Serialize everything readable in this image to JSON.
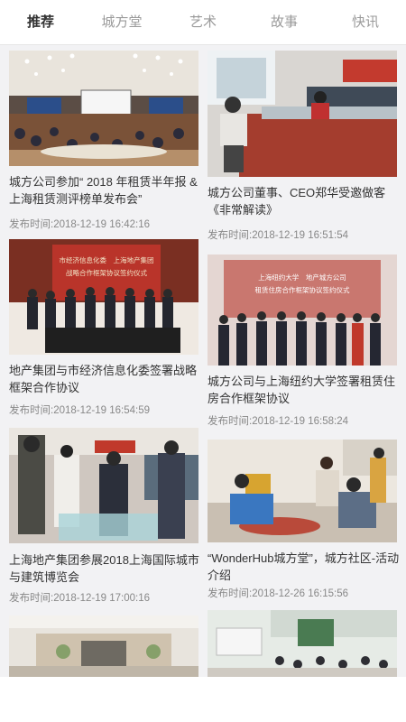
{
  "tabs": [
    {
      "label": "推荐",
      "active": true
    },
    {
      "label": "城方堂",
      "active": false
    },
    {
      "label": "艺术",
      "active": false
    },
    {
      "label": "故事",
      "active": false
    },
    {
      "label": "快讯",
      "active": false
    }
  ],
  "articles": [
    {
      "title": "城方公司参加“ 2018 年租赁半年报 & 上海租赁测评榜单发布会”",
      "time": "发布时间:2018-12-19 16:42:16"
    },
    {
      "title": "城方公司董事、CEO郑华受邀做客《非常解读》",
      "time": "发布时间:2018-12-19 16:51:54"
    },
    {
      "title": "地产集团与市经济信息化委签署战略框架合作协议",
      "time": "发布时间:2018-12-19 16:54:59"
    },
    {
      "title": "城方公司与上海纽约大学签署租赁住房合作框架协议",
      "time": "发布时间:2018-12-19 16:58:24"
    },
    {
      "title": "上海地产集团参展2018上海国际城市与建筑博览会",
      "time": "发布时间:2018-12-19 17:00:16"
    },
    {
      "title": "“WonderHub城方堂”，城方社区-活动介绍",
      "time": "发布时间:2018-12-26 16:15:56"
    }
  ],
  "banners": {
    "signing_left": "市经济信息化委 上海地产集团 战略合作框架协议签约仪式",
    "signing_right": "上海纽约大学 地产城方公司 租赁住房合作框架协议签约仪式"
  },
  "colors": {
    "active_tab": "#333333",
    "inactive_tab": "#9a9a9a",
    "background": "#f2f2f4"
  }
}
